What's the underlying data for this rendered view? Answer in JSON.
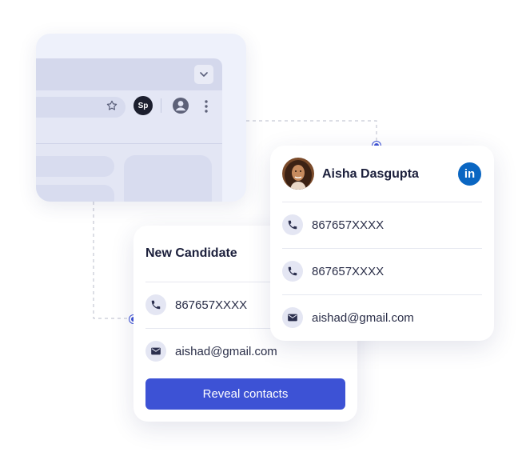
{
  "browser": {
    "extension_label": "Sp"
  },
  "candidate_card": {
    "title": "New Candidate",
    "phone": "867657XXXX",
    "email": "aishad@gmail.com",
    "button_label": "Reveal contacts"
  },
  "profile_card": {
    "name": "Aisha Dasgupta",
    "linkedin_label": "in",
    "phone_1": "867657XXXX",
    "phone_2": "867657XXXX",
    "email": "aishad@gmail.com"
  },
  "colors": {
    "accent": "#3d52d5",
    "linkedin": "#0a66c2"
  }
}
